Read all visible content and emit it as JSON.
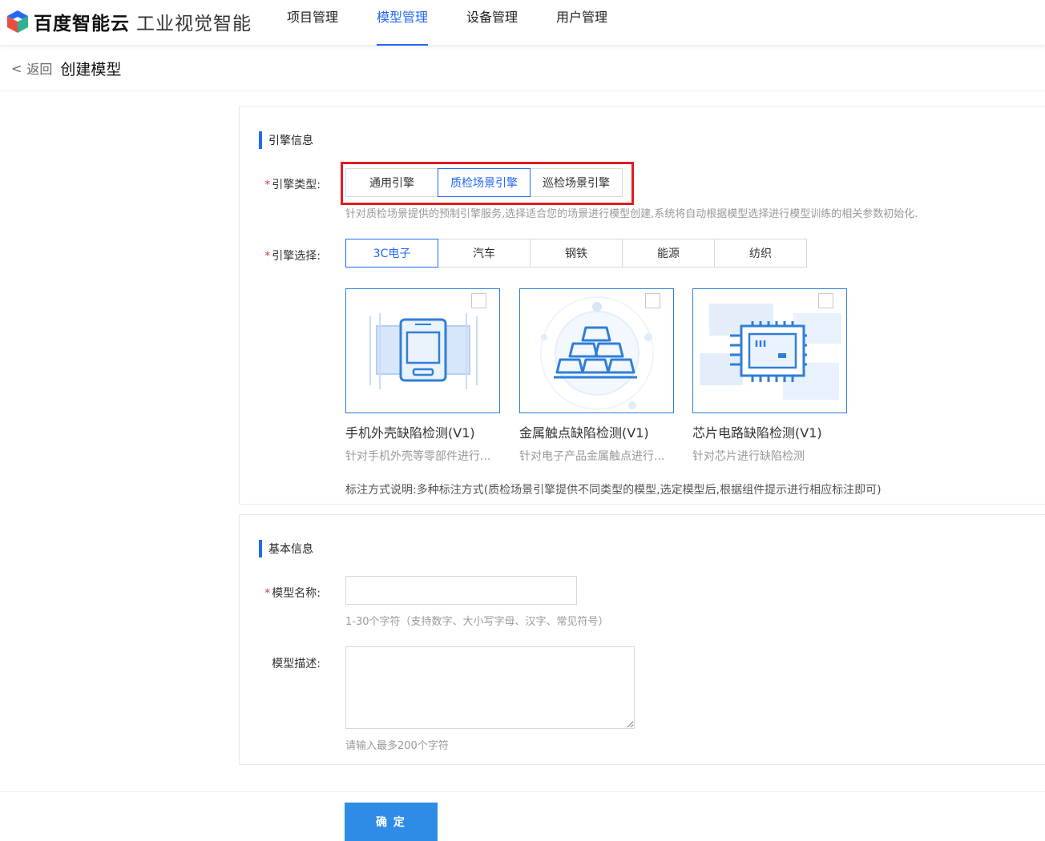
{
  "header": {
    "brand": "百度智能云",
    "product": "工业视觉智能",
    "nav": [
      {
        "label": "项目管理",
        "active": false
      },
      {
        "label": "模型管理",
        "active": true
      },
      {
        "label": "设备管理",
        "active": false
      },
      {
        "label": "用户管理",
        "active": false
      }
    ]
  },
  "subheader": {
    "back_label": "返回",
    "title": "创建模型"
  },
  "engine_section": {
    "title": "引擎信息",
    "type_label": "引擎类型:",
    "type_options": [
      "通用引擎",
      "质检场景引擎",
      "巡检场景引擎"
    ],
    "type_selected": "质检场景引擎",
    "type_hint": "针对质检场景提供的预制引擎服务,选择适合您的场景进行模型创建,系统将自动根据模型选择进行模型训练的相关参数初始化.",
    "select_label": "引擎选择:",
    "select_options": [
      "3C电子",
      "汽车",
      "钢铁",
      "能源",
      "纺织"
    ],
    "select_selected": "3C电子",
    "cards": [
      {
        "title": "手机外壳缺陷检测(V1)",
        "desc": "针对手机外壳等零部件进行...",
        "icon": "phone-icon"
      },
      {
        "title": "金属触点缺陷检测(V1)",
        "desc": "针对电子产品金属触点进行...",
        "icon": "metal-bars-icon"
      },
      {
        "title": "芯片电路缺陷检测(V1)",
        "desc": "针对芯片进行缺陷检测",
        "icon": "chip-icon"
      }
    ],
    "annotation_note": "标注方式说明:多种标注方式(质检场景引擎提供不同类型的模型,选定模型后,根据组件提示进行相应标注即可)"
  },
  "basic_section": {
    "title": "基本信息",
    "name_label": "模型名称:",
    "name_value": "",
    "name_hint": "1-30个字符（支持数字、大小写字母、汉字、常见符号）",
    "desc_label": "模型描述:",
    "desc_value": "",
    "desc_hint": "请输入最多200个字符"
  },
  "footer": {
    "confirm_label": "确 定"
  },
  "colors": {
    "primary": "#2468f2",
    "required": "#e0373f",
    "highlight": "#e01c22",
    "button": "#2f8ce6"
  }
}
